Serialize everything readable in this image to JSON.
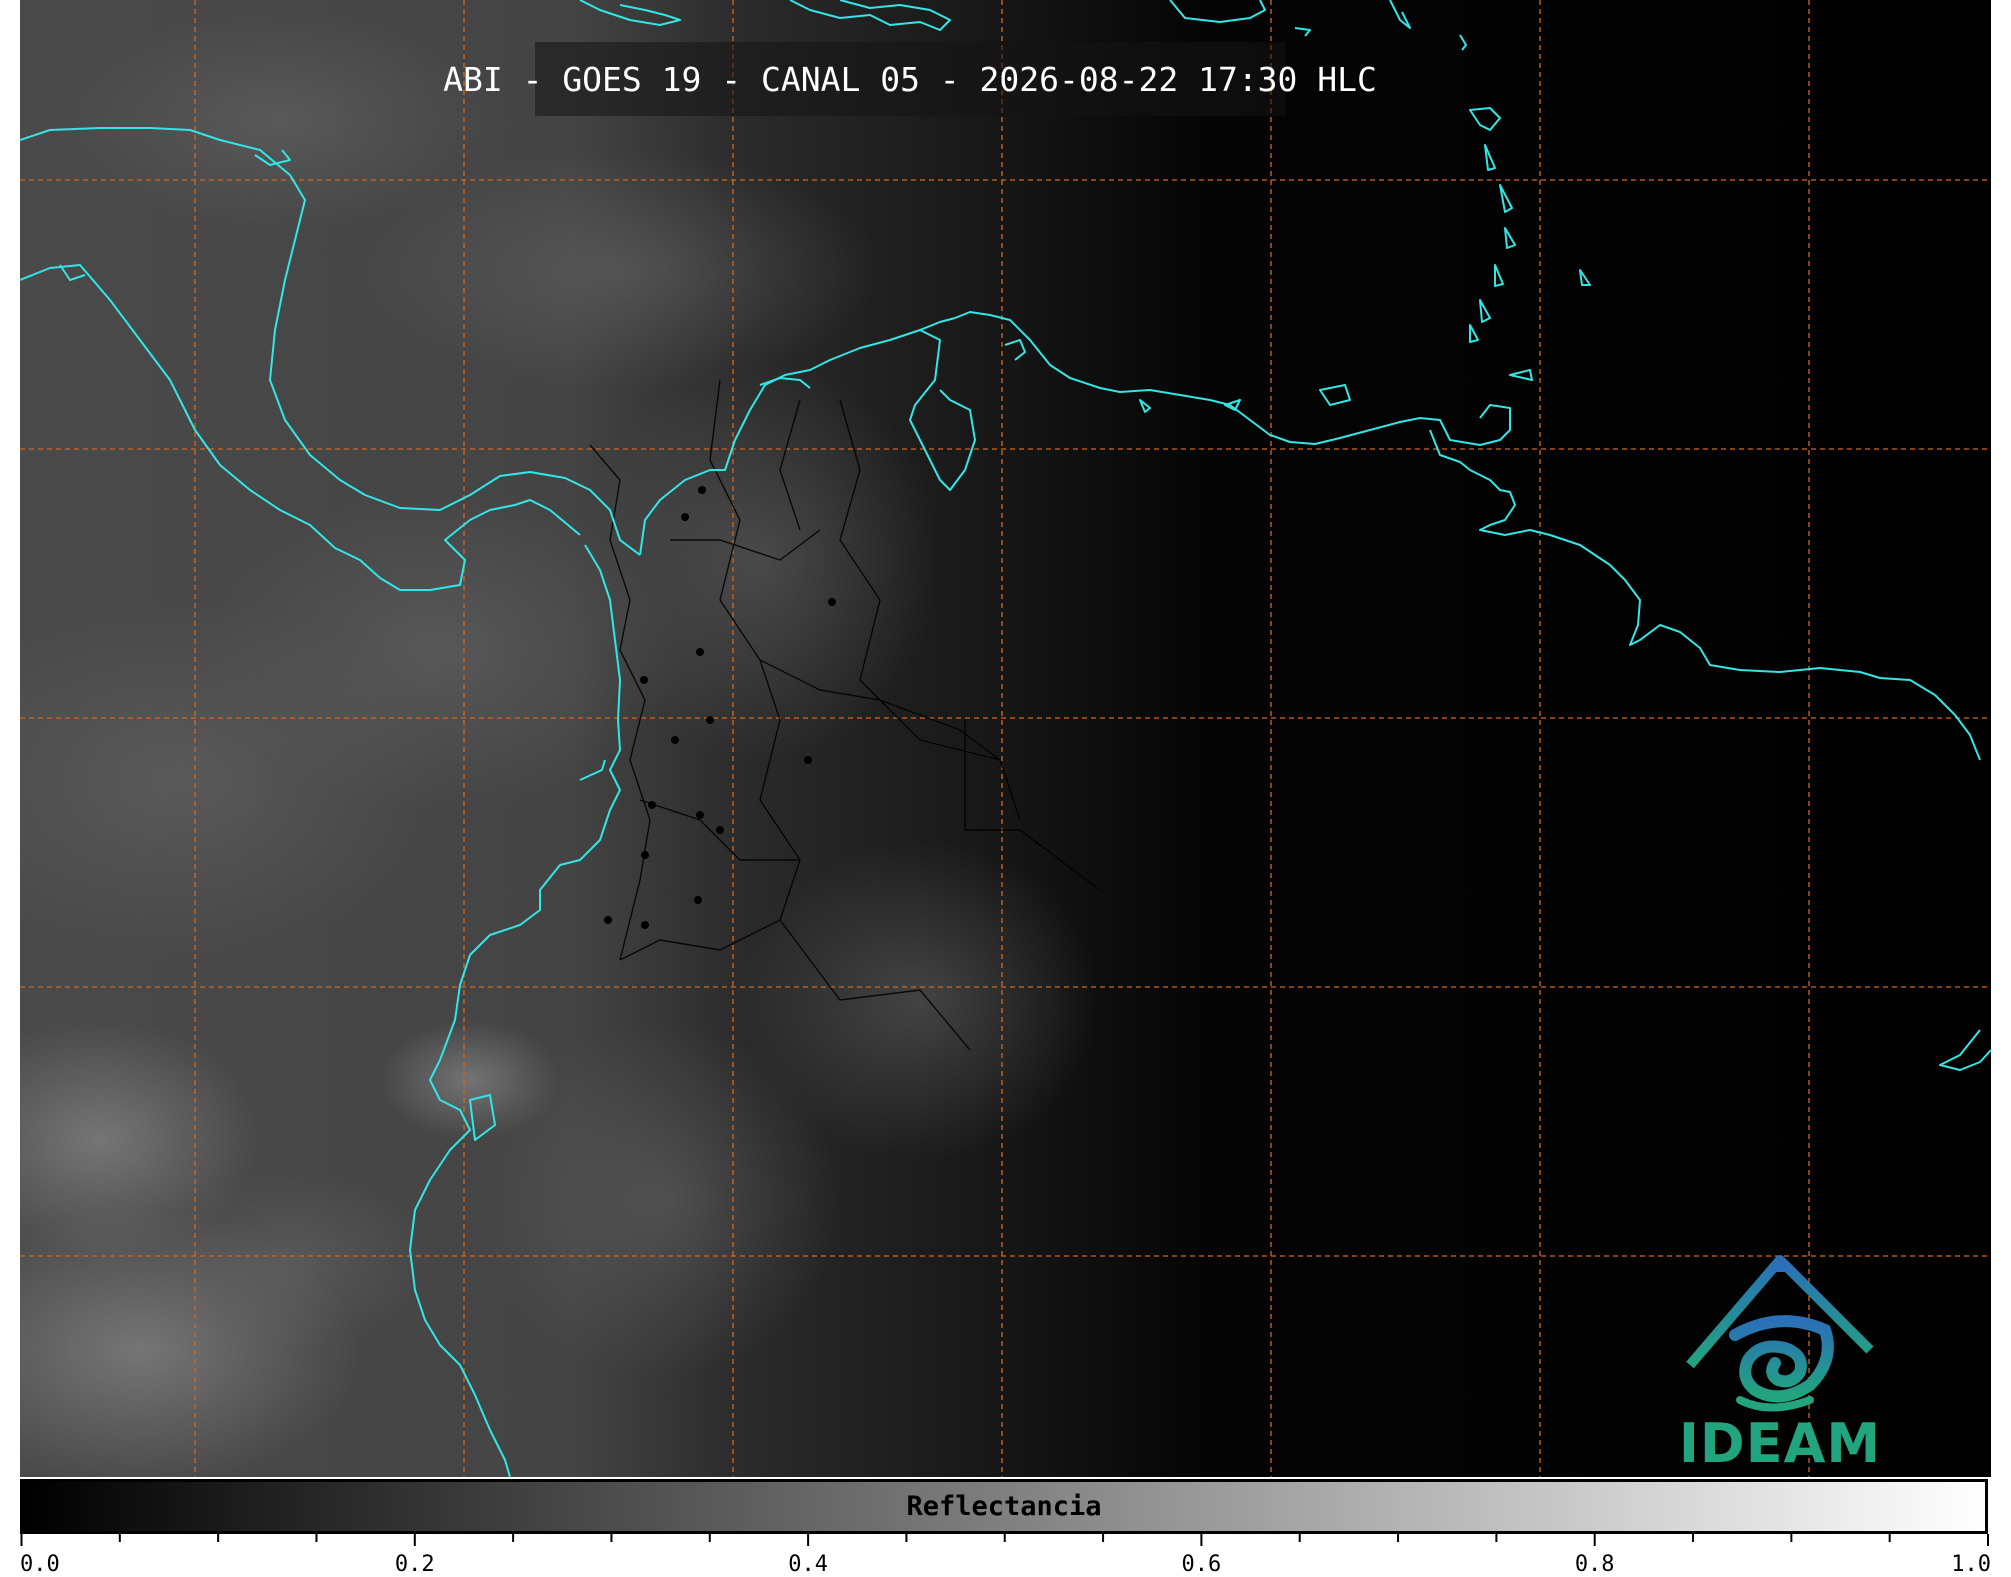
{
  "title": "ABI - GOES 19 - CANAL 05 - 2026-08-22 17:30 HLC",
  "colorbar": {
    "label": "Reflectancia",
    "min": 0.0,
    "max": 1.0,
    "major_ticks": [
      "0.0",
      "0.2",
      "0.4",
      "0.6",
      "0.8",
      "1.0"
    ],
    "minor_step": 0.05,
    "gradient": [
      "#000000",
      "#ffffff"
    ]
  },
  "logo": {
    "text": "IDEAM",
    "colors": [
      "#2a6fb8",
      "#22a57e"
    ]
  },
  "colors": {
    "coastline": "#33e6e6",
    "graticule": "#d2691e",
    "background": "#0a0a0a",
    "borders": "#000000"
  },
  "graticule_lines": {
    "vertical": 7,
    "horizontal": 5
  }
}
